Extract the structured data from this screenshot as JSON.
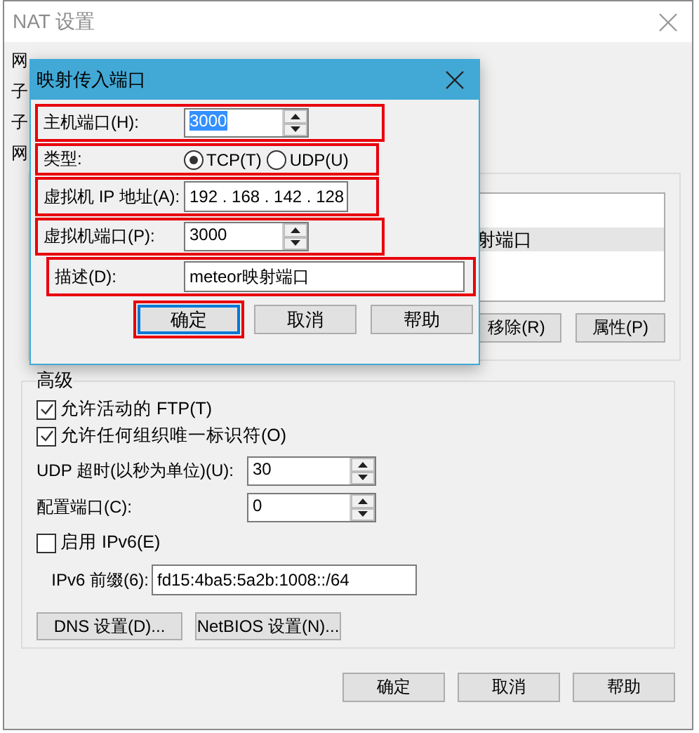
{
  "window": {
    "title": "NAT 设置"
  },
  "background": {
    "labels": [
      "网",
      "子",
      "子",
      "网"
    ],
    "list_rows": [
      {
        "text": "射端口",
        "selected": true
      }
    ],
    "buttons": [
      "移除(R)",
      "属性(P)"
    ]
  },
  "dialog": {
    "title": "映射传入端口",
    "fields": [
      {
        "kind": "spin",
        "label": "主机端口(H):",
        "value": "3000",
        "focused": true,
        "highlighted": true
      },
      {
        "kind": "radio",
        "label": "类型:",
        "options": [
          {
            "label": "TCP(T)",
            "selected": true
          },
          {
            "label": "UDP(U)",
            "selected": false
          }
        ],
        "highlighted": true
      },
      {
        "kind": "ip",
        "label": "虚拟机 IP 地址(A):",
        "value": "192 . 168 . 142 . 128",
        "highlighted": true
      },
      {
        "kind": "spin",
        "label": "虚拟机端口(P):",
        "value": "3000",
        "focused": false,
        "highlighted": true
      },
      {
        "kind": "text",
        "label": "描述(D):",
        "value": "meteor映射端口",
        "highlighted": true
      }
    ],
    "buttons": [
      {
        "label": "确定",
        "default": true,
        "highlighted": true
      },
      {
        "label": "取消",
        "default": false,
        "highlighted": false
      },
      {
        "label": "帮助",
        "default": false,
        "highlighted": false
      }
    ]
  },
  "advanced": {
    "title": "高级",
    "options": [
      {
        "kind": "checkbox",
        "label": "允许活动的 FTP(T)",
        "checked": true
      },
      {
        "kind": "checkbox",
        "label": "允许任何组织唯一标识符(O)",
        "checked": true
      },
      {
        "kind": "spin",
        "label": "UDP 超时(以秒为单位)(U):",
        "value": "30"
      },
      {
        "kind": "spin",
        "label": "配置端口(C):",
        "value": "0"
      },
      {
        "kind": "checkbox",
        "label": "启用 IPv6(E)",
        "checked": false
      },
      {
        "kind": "text",
        "label": "IPv6 前缀(6):",
        "value": "fd15:4ba5:5a2b:1008::/64"
      }
    ],
    "buttons": [
      "DNS 设置(D)...",
      "NetBIOS 设置(N)..."
    ]
  },
  "footer_buttons": [
    "确定",
    "取消",
    "帮助"
  ]
}
